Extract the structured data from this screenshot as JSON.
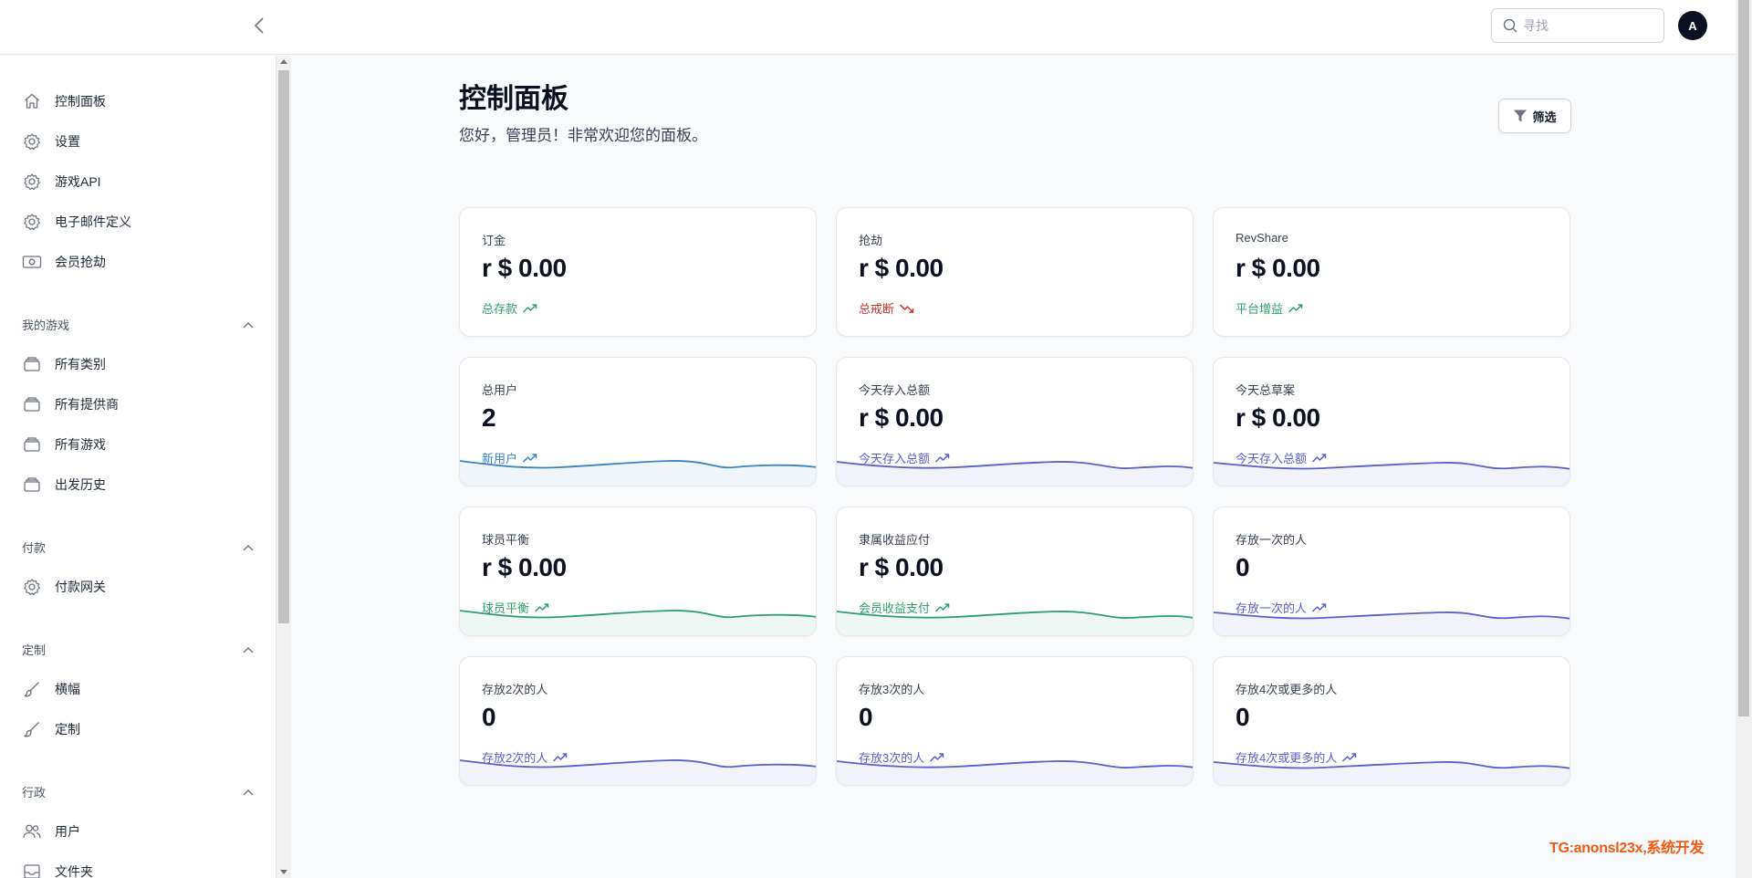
{
  "topbar": {
    "search_placeholder": "寻找",
    "avatar_initial": "A"
  },
  "sidebar": {
    "items_top": [
      {
        "label": "控制面板",
        "icon": "home-icon"
      },
      {
        "label": "设置",
        "icon": "gear-icon"
      },
      {
        "label": "游戏API",
        "icon": "gear-icon"
      },
      {
        "label": "电子邮件定义",
        "icon": "gear-icon"
      },
      {
        "label": "会员抢劫",
        "icon": "cash-icon"
      }
    ],
    "sections": [
      {
        "title": "我的游戏",
        "items": [
          "所有类别",
          "所有提供商",
          "所有游戏",
          "出发历史"
        ]
      },
      {
        "title": "付款",
        "items": [
          "付款网关"
        ]
      },
      {
        "title": "定制",
        "items": [
          "横幅",
          "定制"
        ]
      },
      {
        "title": "行政",
        "items": [
          "用户",
          "文件夹"
        ]
      }
    ]
  },
  "main": {
    "title": "控制面板",
    "subtitle": "您好，管理员！非常欢迎您的面板。",
    "filter_label": "筛选"
  },
  "colors": {
    "green": "#2f9e6e",
    "red": "#c0392b",
    "indigo": "#5b5fc7",
    "blue": "#3b82c4"
  },
  "cards": [
    {
      "label": "订金",
      "value": "r $ 0.00",
      "desc": "总存款",
      "tone": "green",
      "trend": "up",
      "spark": false
    },
    {
      "label": "抢劫",
      "value": "r $ 0.00",
      "desc": "总戒断",
      "tone": "red",
      "trend": "down",
      "spark": false
    },
    {
      "label": "RevShare",
      "value": "r $ 0.00",
      "desc": "平台增益",
      "tone": "green",
      "trend": "up",
      "spark": false
    },
    {
      "label": "总用户",
      "value": "2",
      "desc": "新用户",
      "tone": "blue",
      "trend": "up",
      "spark": true
    },
    {
      "label": "今天存入总额",
      "value": "r $ 0.00",
      "desc": "今天存入总额",
      "tone": "indigo",
      "trend": "up",
      "spark": true
    },
    {
      "label": "今天总草案",
      "value": "r $ 0.00",
      "desc": "今天存入总额",
      "tone": "indigo",
      "trend": "up",
      "spark": true
    },
    {
      "label": "球员平衡",
      "value": "r $ 0.00",
      "desc": "球员平衡",
      "tone": "green",
      "trend": "up",
      "spark": true
    },
    {
      "label": "隶属收益应付",
      "value": "r $ 0.00",
      "desc": "会员收益支付",
      "tone": "green",
      "trend": "up",
      "spark": true
    },
    {
      "label": "存放一次的人",
      "value": "0",
      "desc": "存放一次的人",
      "tone": "indigo",
      "trend": "up",
      "spark": true
    },
    {
      "label": "存放2次的人",
      "value": "0",
      "desc": "存放2次的人",
      "tone": "indigo",
      "trend": "up",
      "spark": true
    },
    {
      "label": "存放3次的人",
      "value": "0",
      "desc": "存放3次的人",
      "tone": "indigo",
      "trend": "up",
      "spark": true
    },
    {
      "label": "存放4次或更多的人",
      "value": "0",
      "desc": "存放4次或更多的人",
      "tone": "indigo",
      "trend": "up",
      "spark": true
    }
  ],
  "watermark": "TG:anonsl23x,系统开发"
}
